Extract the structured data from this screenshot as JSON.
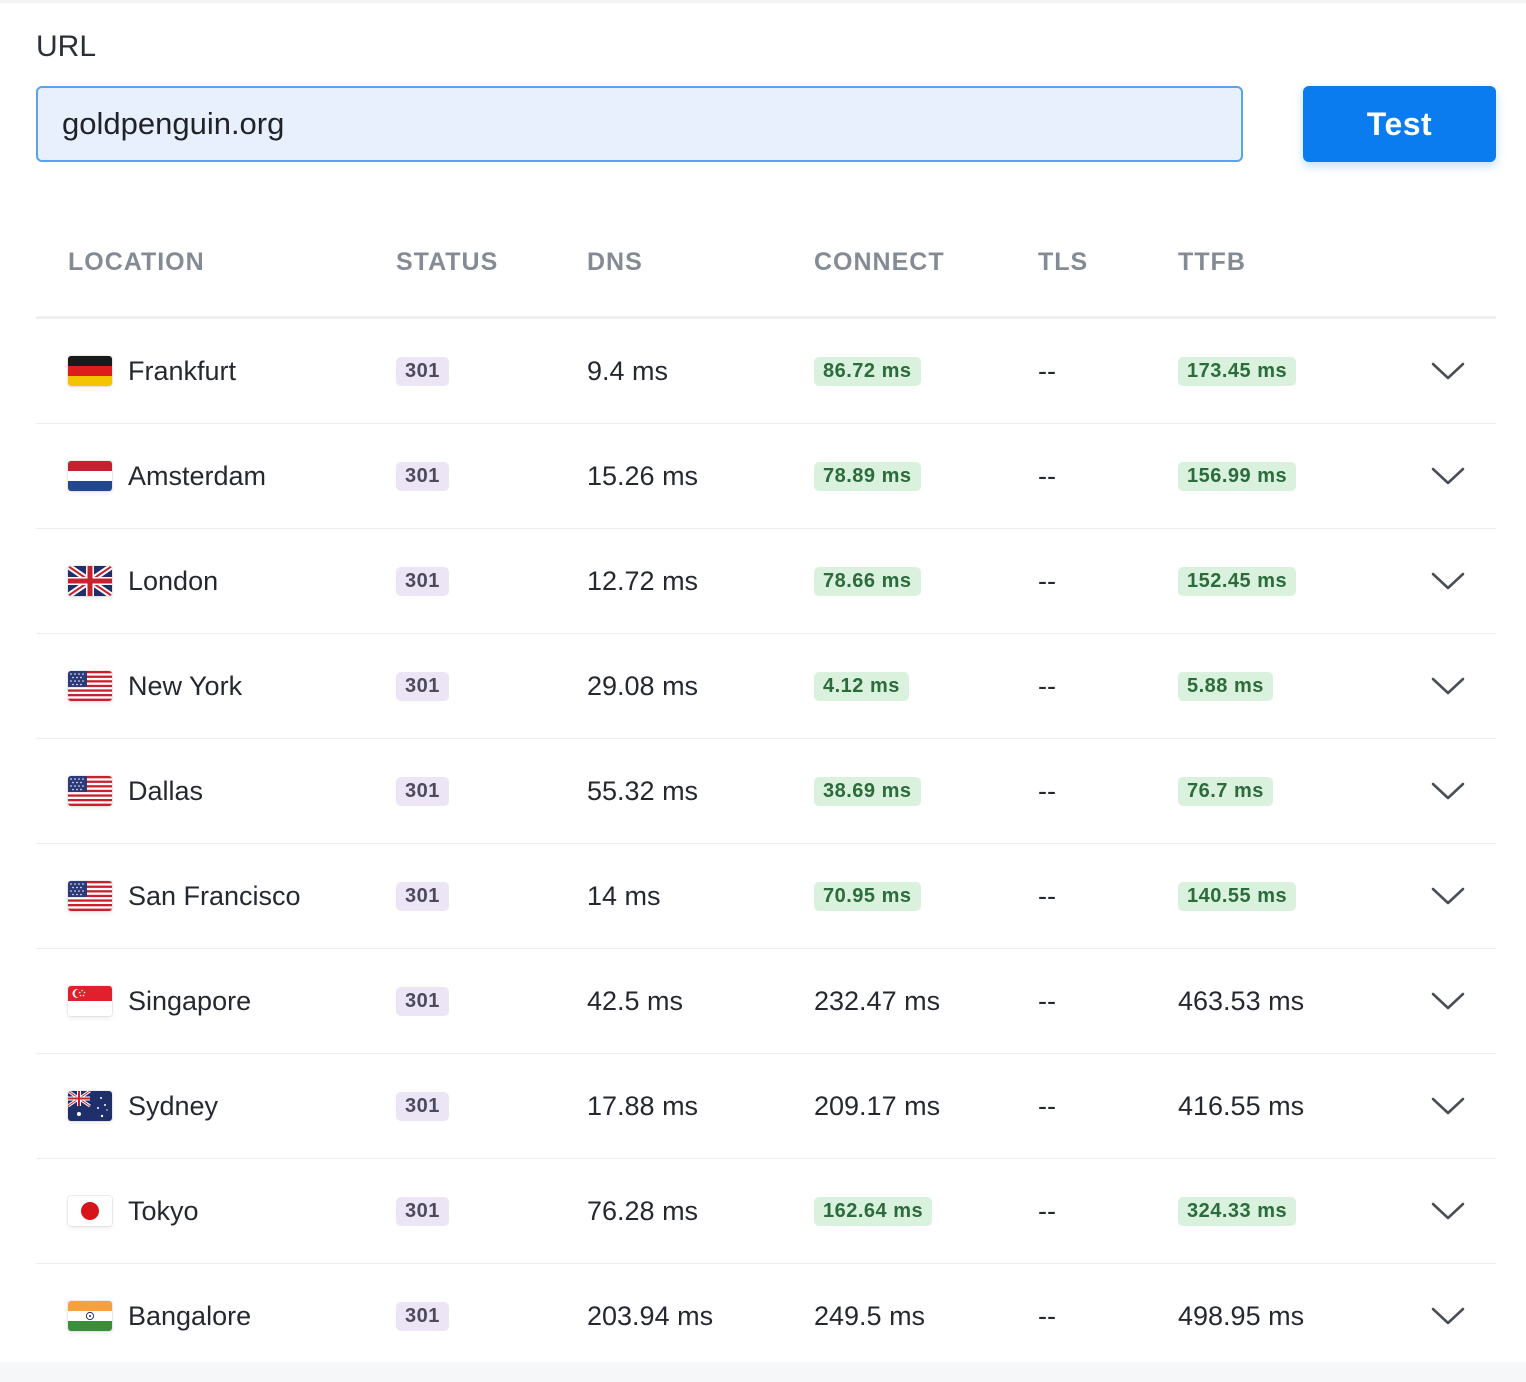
{
  "form": {
    "label": "URL",
    "url_value": "goldpenguin.org",
    "test_button": "Test"
  },
  "table": {
    "headers": [
      "LOCATION",
      "STATUS",
      "DNS",
      "CONNECT",
      "TLS",
      "TTFB"
    ],
    "rows": [
      {
        "flag": "germany-flag-icon",
        "location": "Frankfurt",
        "status": "301",
        "dns": "9.4 ms",
        "connect": "86.72 ms",
        "connect_fast": true,
        "tls": "--",
        "ttfb": "173.45 ms",
        "ttfb_fast": true
      },
      {
        "flag": "netherlands-flag-icon",
        "location": "Amsterdam",
        "status": "301",
        "dns": "15.26 ms",
        "connect": "78.89 ms",
        "connect_fast": true,
        "tls": "--",
        "ttfb": "156.99 ms",
        "ttfb_fast": true
      },
      {
        "flag": "uk-flag-icon",
        "location": "London",
        "status": "301",
        "dns": "12.72 ms",
        "connect": "78.66 ms",
        "connect_fast": true,
        "tls": "--",
        "ttfb": "152.45 ms",
        "ttfb_fast": true
      },
      {
        "flag": "us-flag-icon",
        "location": "New York",
        "status": "301",
        "dns": "29.08 ms",
        "connect": "4.12 ms",
        "connect_fast": true,
        "tls": "--",
        "ttfb": "5.88 ms",
        "ttfb_fast": true
      },
      {
        "flag": "us-flag-icon",
        "location": "Dallas",
        "status": "301",
        "dns": "55.32 ms",
        "connect": "38.69 ms",
        "connect_fast": true,
        "tls": "--",
        "ttfb": "76.7 ms",
        "ttfb_fast": true
      },
      {
        "flag": "us-flag-icon",
        "location": "San Francisco",
        "status": "301",
        "dns": "14 ms",
        "connect": "70.95 ms",
        "connect_fast": true,
        "tls": "--",
        "ttfb": "140.55 ms",
        "ttfb_fast": true
      },
      {
        "flag": "singapore-flag-icon",
        "location": "Singapore",
        "status": "301",
        "dns": "42.5 ms",
        "connect": "232.47 ms",
        "connect_fast": false,
        "tls": "--",
        "ttfb": "463.53 ms",
        "ttfb_fast": false
      },
      {
        "flag": "australia-flag-icon",
        "location": "Sydney",
        "status": "301",
        "dns": "17.88 ms",
        "connect": "209.17 ms",
        "connect_fast": false,
        "tls": "--",
        "ttfb": "416.55 ms",
        "ttfb_fast": false
      },
      {
        "flag": "japan-flag-icon",
        "location": "Tokyo",
        "status": "301",
        "dns": "76.28 ms",
        "connect": "162.64 ms",
        "connect_fast": true,
        "tls": "--",
        "ttfb": "324.33 ms",
        "ttfb_fast": true
      },
      {
        "flag": "india-flag-icon",
        "location": "Bangalore",
        "status": "301",
        "dns": "203.94 ms",
        "connect": "249.5 ms",
        "connect_fast": false,
        "tls": "--",
        "ttfb": "498.95 ms",
        "ttfb_fast": false
      }
    ]
  },
  "colors": {
    "accent": "#0a7cf0",
    "input_bg": "#e8f0fe",
    "fast_badge_bg": "#d9f1dd",
    "fast_badge_text": "#2b6b3c",
    "status_badge_bg": "#ebe5f5"
  }
}
